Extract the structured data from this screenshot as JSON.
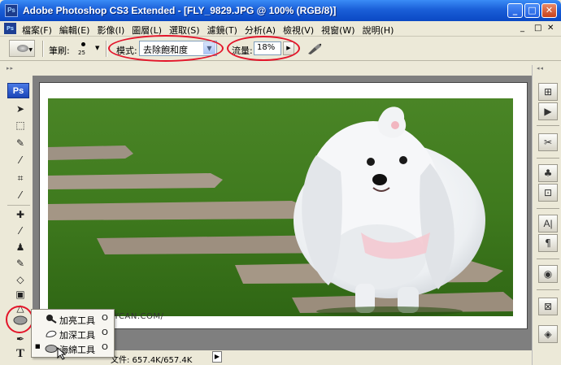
{
  "window": {
    "title": "Adobe Photoshop CS3 Extended - [FLY_9829.JPG @ 100% (RGB/8)]",
    "app_badge": "Ps",
    "buttons": {
      "minimize": "_",
      "maximize": "□",
      "close": "✕"
    }
  },
  "menu": {
    "items": [
      "檔案(F)",
      "編輯(E)",
      "影像(I)",
      "圖層(L)",
      "選取(S)",
      "濾鏡(T)",
      "分析(A)",
      "檢視(V)",
      "視窗(W)",
      "說明(H)"
    ],
    "doc_controls": [
      "_",
      "□",
      "✕"
    ]
  },
  "options": {
    "brush_label": "筆刷:",
    "brush_size": "25",
    "mode_label": "模式:",
    "mode_value": "去除飽和度",
    "flow_label": "流量:",
    "flow_value": "18%"
  },
  "toolbox": {
    "ps_logo": "Ps",
    "type_tool": "T"
  },
  "canvas": {
    "watermark": "YCAN.COM/"
  },
  "status": {
    "doc_info": "文件: 657.4K/657.4K",
    "arrow": "▶"
  },
  "flyout": {
    "items": [
      {
        "label": "加亮工具",
        "key": "O",
        "selected": false
      },
      {
        "label": "加深工具",
        "key": "O",
        "selected": false
      },
      {
        "label": "海綿工具",
        "key": "O",
        "selected": true
      }
    ]
  },
  "colors": {
    "titlebar": "#1a5fd8",
    "annotation": "#e3152a",
    "grass": "#3f7a1e"
  }
}
